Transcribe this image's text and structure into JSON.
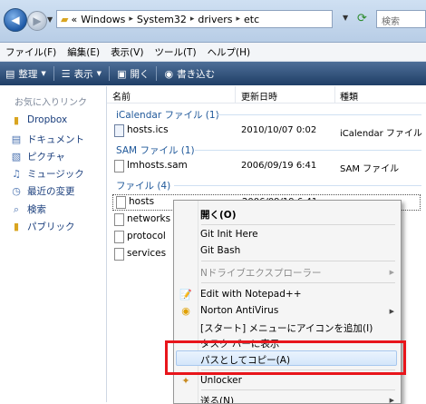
{
  "address_bar": {
    "path_prefix": "«",
    "segments": [
      "Windows",
      "System32",
      "drivers",
      "etc"
    ],
    "search_placeholder": "検索"
  },
  "menubar": [
    "ファイル(F)",
    "編集(E)",
    "表示(V)",
    "ツール(T)",
    "ヘルプ(H)"
  ],
  "toolbar": {
    "organize": "整理",
    "views": "表示",
    "open": "開く",
    "burn": "書き込む"
  },
  "left_pane": {
    "header": "お気に入りリンク",
    "items": [
      {
        "label": "Dropbox",
        "icon": "folder-icon"
      },
      {
        "label": "ドキュメント",
        "icon": "documents-icon"
      },
      {
        "label": "ピクチャ",
        "icon": "pictures-icon"
      },
      {
        "label": "ミュージック",
        "icon": "music-icon"
      },
      {
        "label": "最近の変更",
        "icon": "recent-icon"
      },
      {
        "label": "検索",
        "icon": "search-icon"
      },
      {
        "label": "パブリック",
        "icon": "folder-icon"
      }
    ]
  },
  "columns": {
    "name": "名前",
    "date": "更新日時",
    "type": "種類"
  },
  "groups": [
    {
      "label": "iCalendar ファイル (1)",
      "files": [
        {
          "name": "hosts.ics",
          "date": "2010/10/07 0:02",
          "type": "iCalendar ファイル"
        }
      ]
    },
    {
      "label": "SAM ファイル (1)",
      "files": [
        {
          "name": "lmhosts.sam",
          "date": "2006/09/19 6:41",
          "type": "SAM ファイル"
        }
      ]
    },
    {
      "label": "ファイル (4)",
      "files": [
        {
          "name": "hosts",
          "date": "2006/09/19 6:41",
          "type": "ファイル"
        },
        {
          "name": "networks"
        },
        {
          "name": "protocol"
        },
        {
          "name": "services"
        }
      ]
    }
  ],
  "context_menu": {
    "open": "開く(O)",
    "git_init": "Git Init Here",
    "git_bash": "Git Bash",
    "n_drive": "Nドライブエクスプローラー",
    "notepad": "Edit with Notepad++",
    "norton": "Norton AntiVirus",
    "add_start": "[スタート] メニューにアイコンを追加(I)",
    "taskbar": "タスク バーに表示",
    "copy_path": "パスとしてコピー(A)",
    "unlocker": "Unlocker",
    "send_to": "送る(N)"
  },
  "colors": {
    "highlight": "#e8151b",
    "toolbar": "#2a4a74",
    "link": "#1a3e7c"
  }
}
